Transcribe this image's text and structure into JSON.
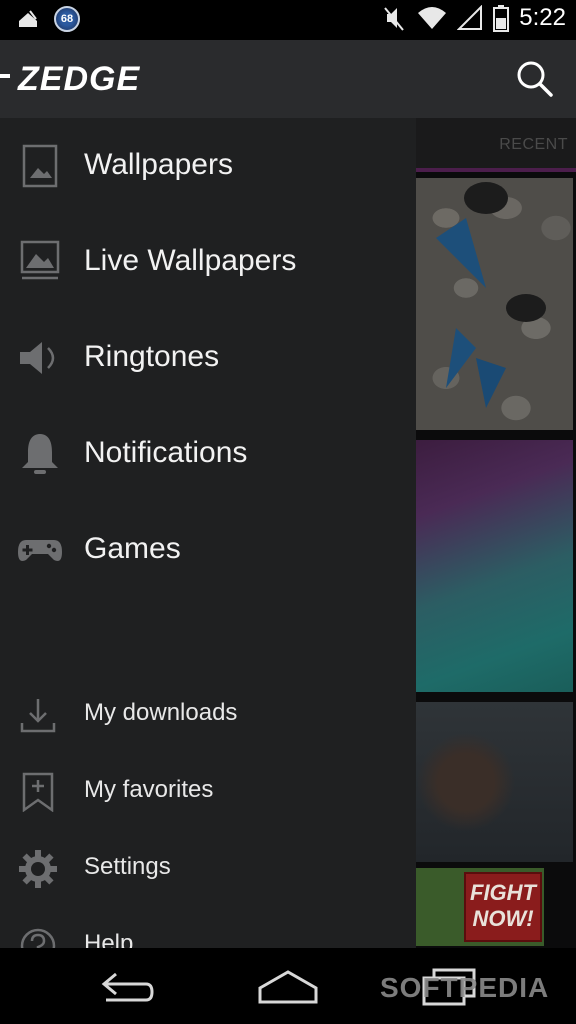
{
  "status_bar": {
    "badge_number": "68",
    "time": "5:22",
    "icons": [
      "debug-android-icon",
      "notification-badge-icon",
      "mute-icon",
      "wifi-icon",
      "signal-icon",
      "battery-icon"
    ]
  },
  "app_bar": {
    "logo_text": "ZEDGE",
    "search_icon": "search-icon"
  },
  "background": {
    "tab_label": "RECENT",
    "promo_text": "FIGHT NOW!"
  },
  "drawer": {
    "primary_items": [
      {
        "label": "Wallpapers",
        "icon": "wallpaper-icon"
      },
      {
        "label": "Live Wallpapers",
        "icon": "live-wallpaper-icon"
      },
      {
        "label": "Ringtones",
        "icon": "speaker-icon"
      },
      {
        "label": "Notifications",
        "icon": "bell-icon"
      },
      {
        "label": "Games",
        "icon": "gamepad-icon"
      }
    ],
    "secondary_items": [
      {
        "label": "My downloads",
        "icon": "download-icon"
      },
      {
        "label": "My favorites",
        "icon": "bookmark-plus-icon"
      },
      {
        "label": "Settings",
        "icon": "gear-icon"
      },
      {
        "label": "Help",
        "icon": "help-icon"
      }
    ]
  },
  "nav_bar": {
    "buttons": [
      "back-icon",
      "home-icon",
      "recents-icon"
    ],
    "watermark": "SOFTPEDIA"
  },
  "colors": {
    "drawer_bg": "#1f2021",
    "appbar_bg": "#2a2b2d",
    "tab_indicator": "#4c1e4c"
  }
}
